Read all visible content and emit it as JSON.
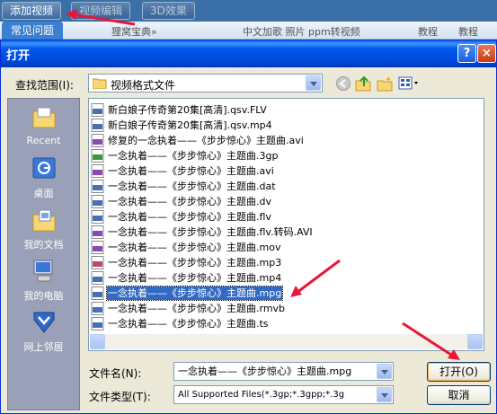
{
  "app": {
    "tabs": [
      {
        "label": "添加视频",
        "active": true
      },
      {
        "label": "视频编辑",
        "active": false
      },
      {
        "label": "3D效果",
        "active": false
      }
    ],
    "faq_tab": "常见问题",
    "strip_texts": [
      "狸窝宝典»",
      "中文加歌 照片 ppm转视频",
      "教程",
      "教程"
    ]
  },
  "dialog": {
    "title": "打开",
    "help_label": "?",
    "close_label": "×",
    "look_in_label": "查找范围(I):",
    "look_in_value": "视频格式文件",
    "places": [
      {
        "label": "Recent",
        "icon": "recent-documents-icon"
      },
      {
        "label": "桌面",
        "icon": "desktop-icon"
      },
      {
        "label": "我的文档",
        "icon": "my-documents-icon"
      },
      {
        "label": "我的电脑",
        "icon": "my-computer-icon"
      },
      {
        "label": "网上邻居",
        "icon": "network-places-icon"
      }
    ],
    "files": [
      {
        "name": "新白娘子传奇第20集[高清].qsv.FLV",
        "icon": "flv-file-icon",
        "selected": false
      },
      {
        "name": "新白娘子传奇第20集[高清].qsv.mp4",
        "icon": "mp4-file-icon",
        "selected": false
      },
      {
        "name": "修复的一念执着——《步步惊心》主题曲.avi",
        "icon": "avi-file-icon",
        "selected": false
      },
      {
        "name": "一念执着——《步步惊心》主题曲.3gp",
        "icon": "3gp-file-icon",
        "selected": false
      },
      {
        "name": "一念执着——《步步惊心》主题曲.avi",
        "icon": "avi-file-icon",
        "selected": false
      },
      {
        "name": "一念执着——《步步惊心》主题曲.dat",
        "icon": "dat-file-icon",
        "selected": false
      },
      {
        "name": "一念执着——《步步惊心》主题曲.dv",
        "icon": "dv-file-icon",
        "selected": false
      },
      {
        "name": "一念执着——《步步惊心》主题曲.flv",
        "icon": "flv-file-icon",
        "selected": false
      },
      {
        "name": "一念执着——《步步惊心》主题曲.flv.转码.AVI",
        "icon": "avi-file-icon",
        "selected": false
      },
      {
        "name": "一念执着——《步步惊心》主题曲.mov",
        "icon": "mov-file-icon",
        "selected": false
      },
      {
        "name": "一念执着——《步步惊心》主题曲.mp3",
        "icon": "mp3-file-icon",
        "selected": false
      },
      {
        "name": "一念执着——《步步惊心》主题曲.mp4",
        "icon": "mp4-file-icon",
        "selected": false
      },
      {
        "name": "一念执着——《步步惊心》主题曲.mpg",
        "icon": "mpg-file-icon",
        "selected": true
      },
      {
        "name": "一念执着——《步步惊心》主题曲.rmvb",
        "icon": "rmvb-file-icon",
        "selected": false
      },
      {
        "name": "一念执着——《步步惊心》主题曲.ts",
        "icon": "ts-file-icon",
        "selected": false
      }
    ],
    "filename_label": "文件名(N):",
    "filename_value": "一念执着——《步步惊心》主题曲.mpg",
    "filetype_label": "文件类型(T):",
    "filetype_value": "All Supported Files(*.3gp;*.3gpp;*.3g",
    "open_label": "打开(O)",
    "cancel_label": "取消"
  },
  "colors": {
    "titlebar": "#0054e3",
    "selection": "#316ac5",
    "annotation_arrow": "#e8173a"
  }
}
